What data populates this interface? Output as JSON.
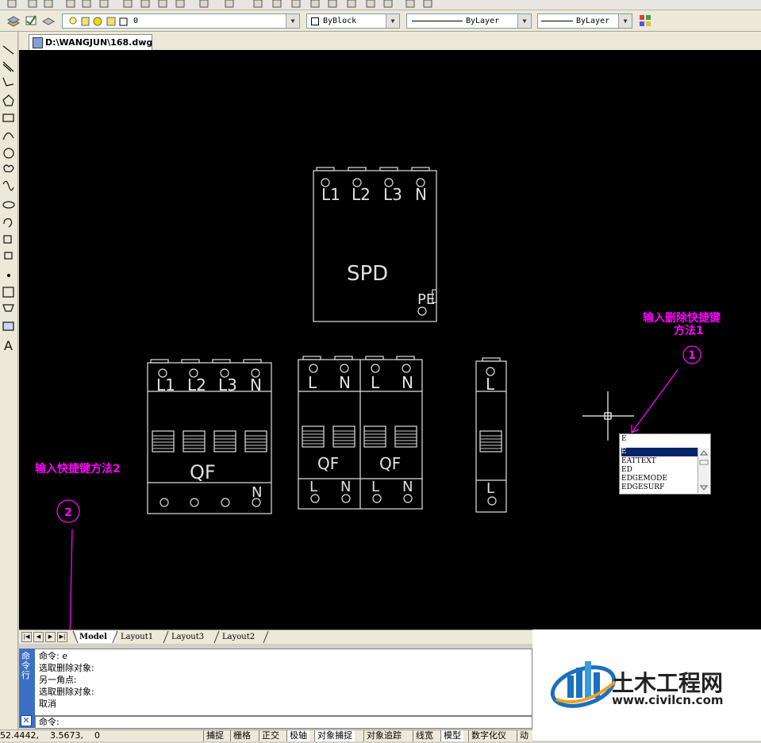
{
  "window": {
    "doc_tab": "D:\\WANGJUN\\168.dwg"
  },
  "properties_toolbar": {
    "layer_value": "0",
    "color_value": "ByBlock",
    "linetype_value": "ByLayer",
    "lineweight_value": "ByLayer"
  },
  "drawing": {
    "spd": {
      "terminals": [
        "L1",
        "L2",
        "L3",
        "N"
      ],
      "label": "SPD",
      "pe_label": "PE"
    },
    "qf4p": {
      "terminals": [
        "L1",
        "L2",
        "L3",
        "N"
      ],
      "label": "QF",
      "bottom_label": "N"
    },
    "qf2p_a": {
      "terminals": [
        "L",
        "N"
      ],
      "label": "QF",
      "bottom": [
        "L",
        "N"
      ]
    },
    "qf2p_b": {
      "terminals": [
        "L",
        "N"
      ],
      "label": "QF",
      "bottom": [
        "L",
        "N"
      ]
    },
    "qf1p": {
      "terminals": [
        "L"
      ],
      "bottom": [
        "L"
      ]
    }
  },
  "annotations": {
    "method1_line1": "输入删除快捷键",
    "method1_line2": "方法1",
    "marker1": "1",
    "method2": "输入快捷键方法2",
    "marker2": "2"
  },
  "autocomplete": {
    "input": "E",
    "items": [
      "E",
      "EATTEXT",
      "ED",
      "EDGEMODE",
      "EDGESURF"
    ],
    "selected_index": 0
  },
  "layout_tabs": [
    "Model",
    "Layout1",
    "Layout3",
    "Layout2"
  ],
  "command": {
    "side_label": "命令行",
    "history": [
      "命令: e",
      "选取删除对象:",
      "另一角点:",
      "选取删除对象:",
      "取消"
    ],
    "prompt": "命令:"
  },
  "status": {
    "coords": "52.4442,    3.5673,    0",
    "toggles": [
      "捕捉",
      "栅格",
      "正交",
      "极轴",
      "对象捕捉",
      "对象追踪",
      "线宽",
      "模型",
      "数字化仪",
      "动"
    ]
  },
  "watermark": {
    "title": "土木工程网",
    "url": "www.civilcn.com"
  },
  "colors": {
    "canvas": "#000000",
    "annotation": "#ff00ff",
    "selection": "#0a246a"
  }
}
